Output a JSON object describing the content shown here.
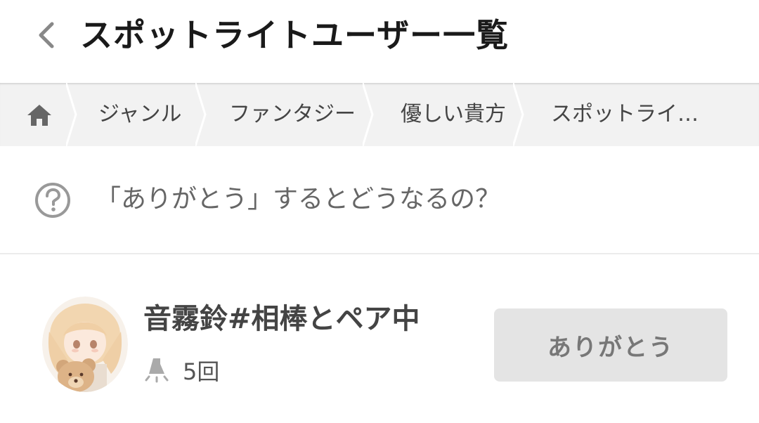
{
  "header": {
    "title": "スポットライトユーザー一覧",
    "back_icon": "chevron-left-icon"
  },
  "breadcrumb": {
    "home_icon": "home-icon",
    "items": [
      {
        "label": "ジャンル"
      },
      {
        "label": "ファンタジー"
      },
      {
        "label": "優しい貴方"
      },
      {
        "label": "スポットライ…"
      }
    ]
  },
  "help": {
    "icon": "question-circle-icon",
    "text": "「ありがとう」するとどうなるの？"
  },
  "users": [
    {
      "name": "音霧鈴#相棒とペア中",
      "count": "5回",
      "count_icon": "spotlight-lamp-icon",
      "button_label": "ありがとう"
    }
  ],
  "colors": {
    "breadcrumb_bg": "#f2f2f2",
    "button_bg": "#e4e4e4",
    "title": "#1a1a1a"
  }
}
